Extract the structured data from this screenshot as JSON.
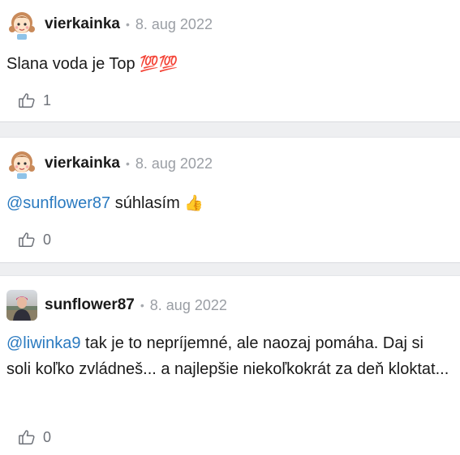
{
  "comments": [
    {
      "author": "vierkainka",
      "date": "8. aug 2022",
      "mention": "",
      "text": "Slana voda je Top ",
      "emoji": "💯💯",
      "likes": "1",
      "avatar_icon": "girl-cartoon-avatar"
    },
    {
      "author": "vierkainka",
      "date": "8. aug 2022",
      "mention": "@sunflower87",
      "text": " súhlasím ",
      "emoji": "👍",
      "likes": "0",
      "avatar_icon": "girl-cartoon-avatar"
    },
    {
      "author": "sunflower87",
      "date": "8. aug 2022",
      "mention": "@liwinka9",
      "text": " tak je to nepríjemné, ale naozaj pomáha. Daj si soli koľko zvládneš... a najlepšie niekoľkokrát za deň kloktat...",
      "emoji": "",
      "likes": "0",
      "avatar_icon": "user-photo-avatar"
    }
  ],
  "separator": "•",
  "colors": {
    "mention": "#2a7ac0",
    "meta": "#9a9ea4",
    "divider": "#eeeff1"
  }
}
